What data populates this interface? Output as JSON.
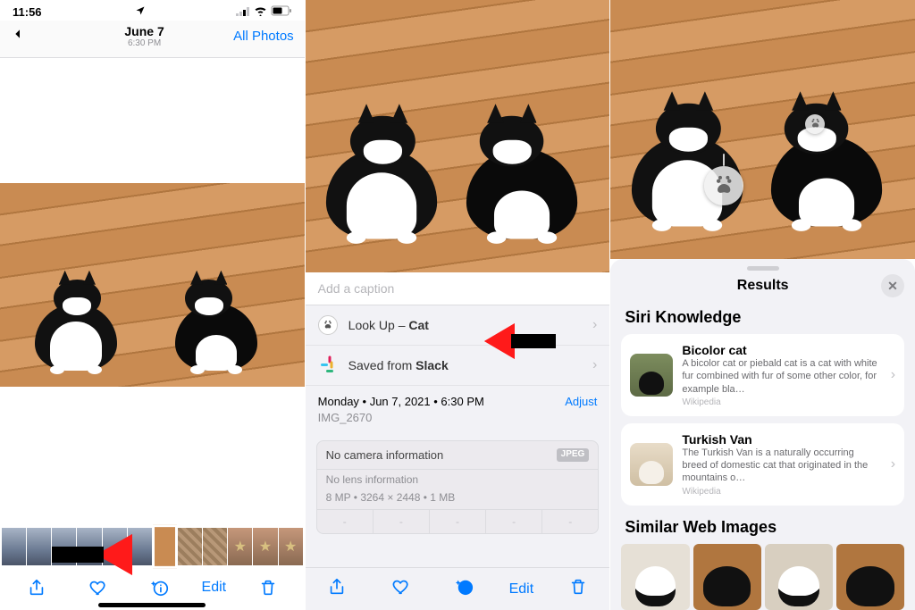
{
  "panel1": {
    "status_time": "11:56",
    "nav_date": "June 7",
    "nav_time": "6:30 PM",
    "all_photos": "All Photos",
    "edit": "Edit"
  },
  "panel2": {
    "caption_placeholder": "Add a caption",
    "lookup_prefix": "Look Up – ",
    "lookup_subject": "Cat",
    "saved_prefix": "Saved from ",
    "saved_source": "Slack",
    "date_line": "Monday • Jun 7, 2021 • 6:30 PM",
    "adjust": "Adjust",
    "filename": "IMG_2670",
    "no_camera": "No camera information",
    "format_badge": "JPEG",
    "no_lens": "No lens information",
    "specs": "8 MP • 3264 × 2448 • 1 MB",
    "edit": "Edit"
  },
  "panel3": {
    "results_title": "Results",
    "siri_heading": "Siri Knowledge",
    "items": [
      {
        "title": "Bicolor cat",
        "desc": "A bicolor cat or piebald cat is a cat with white fur combined with fur of some other color, for example bla…",
        "source": "Wikipedia"
      },
      {
        "title": "Turkish Van",
        "desc": "The Turkish Van is a naturally occurring breed of domestic cat that originated in the mountains o…",
        "source": "Wikipedia"
      }
    ],
    "similar_heading": "Similar Web Images"
  }
}
